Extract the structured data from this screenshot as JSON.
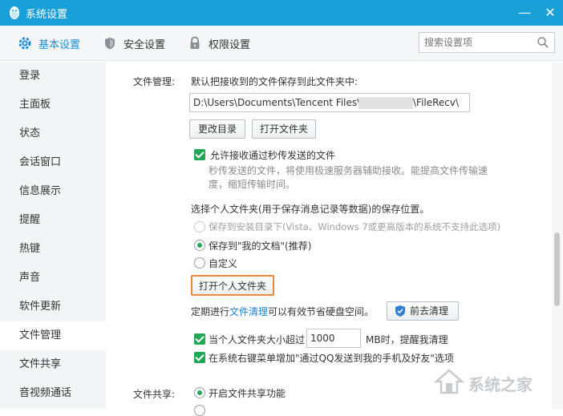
{
  "window": {
    "title": "系统设置",
    "minimize": "—",
    "close": "✕"
  },
  "tabs": [
    {
      "label": "基本设置",
      "icon": "gear-icon"
    },
    {
      "label": "安全设置",
      "icon": "shield-icon"
    },
    {
      "label": "权限设置",
      "icon": "lock-icon"
    }
  ],
  "search": {
    "placeholder": "搜索设置项"
  },
  "sidebar": {
    "items": [
      {
        "label": "登录"
      },
      {
        "label": "主面板"
      },
      {
        "label": "状态"
      },
      {
        "label": "会话窗口"
      },
      {
        "label": "信息展示"
      },
      {
        "label": "提醒"
      },
      {
        "label": "热键"
      },
      {
        "label": "声音"
      },
      {
        "label": "软件更新"
      },
      {
        "label": "文件管理"
      },
      {
        "label": "文件共享"
      },
      {
        "label": "音视频通话"
      }
    ],
    "active": "文件管理"
  },
  "file_manage": {
    "section_label": "文件管理:",
    "save_desc": "默认把接收到的文件保存到此文件夹中:",
    "path_prefix": "D:\\Users\\Documents\\Tencent Files\\",
    "path_suffix": "\\FileRecv\\",
    "change_dir_btn": "更改目录",
    "open_folder_btn": "打开文件夹",
    "allow_instant": "允许接收通过秒传发送的文件",
    "instant_hint_1": "秒传发送的文件，将使用极速服务器辅助接收。能提高文件传输速",
    "instant_hint_2": "度，缩短传输时间。",
    "personal_folder_desc": "选择个人文件夹(用于保存消息记录等数据)的保存位置。",
    "opt_install_dir": "保存到安装目录下(Vista、Windows 7或更高版本的系统不支持此选项)",
    "opt_my_docs": "保存到\"我的文档\"(推荐)",
    "opt_custom": "自定义",
    "open_personal_btn": "打开个人文件夹",
    "clean_prefix": "定期进行",
    "clean_link": "文件清理",
    "clean_suffix": "可以有效节省硬盘空间。",
    "clean_btn": "前去清理",
    "size_limit_prefix": "当个人文件夹大小超过",
    "size_limit_value": "1000",
    "size_limit_suffix": "MB时，提醒我清理",
    "context_menu": "在系统右键菜单增加\"通过QQ发送到我的手机及好友\"选项"
  },
  "file_share": {
    "section_label": "文件共享:",
    "enable_share": "开启文件共享功能"
  },
  "watermark": {
    "text": "系统之家"
  },
  "colors": {
    "titlebar": "#1aa0d8",
    "accent": "#1a8fd9",
    "check": "#20a854",
    "highlight": "#e98a3e"
  }
}
